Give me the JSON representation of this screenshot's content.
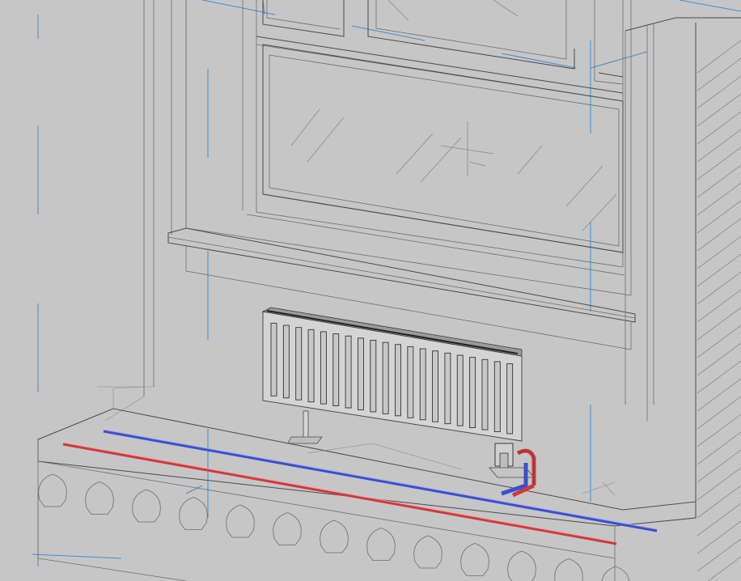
{
  "view": {
    "type": "3d-model-view",
    "background": "#c6c6c6"
  },
  "colors": {
    "edge": "#6e6e6e",
    "dark_edge": "#4a4a4a",
    "grid_line": "#3f8fd0",
    "supply_pipe": "#d03a3a",
    "return_pipe": "#3a4fd0",
    "radiator_body": "#d4d4d4"
  },
  "elements": [
    {
      "name": "window",
      "icon": "window-frame"
    },
    {
      "name": "window-sill",
      "icon": "sill"
    },
    {
      "name": "radiator",
      "icon": "panel-radiator",
      "fin_count": 20
    },
    {
      "name": "radiator-valve",
      "icon": "valve"
    },
    {
      "name": "supply-pipe",
      "color": "red"
    },
    {
      "name": "return-pipe",
      "color": "blue"
    },
    {
      "name": "floor-slab",
      "icon": "hollow-core-slab"
    },
    {
      "name": "side-wall",
      "icon": "wall-hatch"
    }
  ]
}
